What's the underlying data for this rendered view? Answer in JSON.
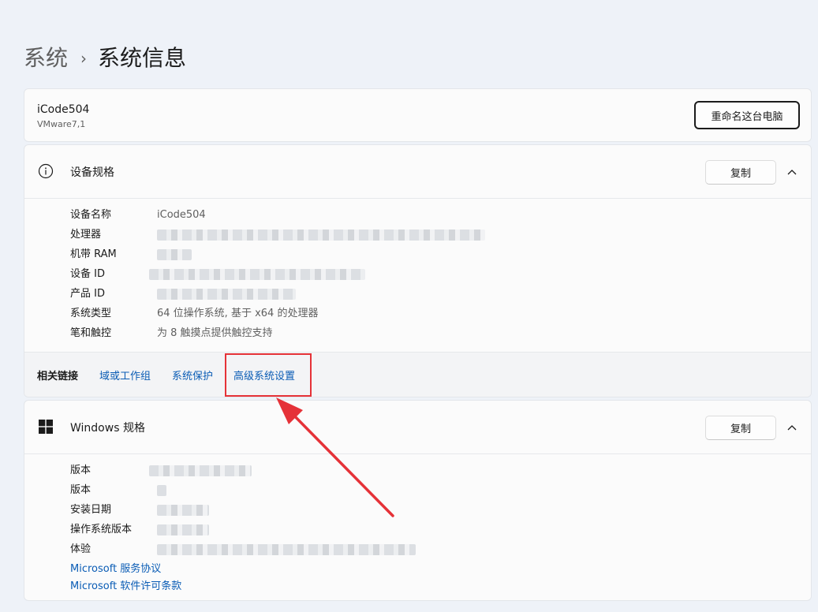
{
  "breadcrumb": {
    "parent": "系统",
    "separator": "›",
    "current": "系统信息"
  },
  "device": {
    "name": "iCode504",
    "model": "VMware7,1",
    "rename_label": "重命名这台电脑"
  },
  "device_spec": {
    "title": "设备规格",
    "copy_label": "复制",
    "icon": "info-icon",
    "rows": [
      {
        "label": "设备名称",
        "value": "iCode504"
      },
      {
        "label": "处理器",
        "value": ""
      },
      {
        "label": "机带 RAM",
        "value": ""
      },
      {
        "label": "设备 ID",
        "value": ""
      },
      {
        "label": "产品 ID",
        "value": ""
      },
      {
        "label": "系统类型",
        "value": "64 位操作系统, 基于 x64 的处理器"
      },
      {
        "label": "笔和触控",
        "value": "为 8 触摸点提供触控支持"
      }
    ]
  },
  "related_links": {
    "label": "相关链接",
    "links": [
      "域或工作组",
      "系统保护",
      "高级系统设置"
    ],
    "highlighted": "高级系统设置"
  },
  "windows_spec": {
    "title": "Windows 规格",
    "copy_label": "复制",
    "icon": "windows-logo-icon",
    "rows": [
      {
        "label": "版本",
        "value": ""
      },
      {
        "label": "版本",
        "value": ""
      },
      {
        "label": "安装日期",
        "value": ""
      },
      {
        "label": "操作系统版本",
        "value": ""
      },
      {
        "label": "体验",
        "value": ""
      }
    ],
    "links": [
      "Microsoft 服务协议",
      "Microsoft 软件许可条款"
    ]
  },
  "colors": {
    "link": "#0a5cb5",
    "highlight": "#e53238",
    "background": "#eef2f8"
  }
}
